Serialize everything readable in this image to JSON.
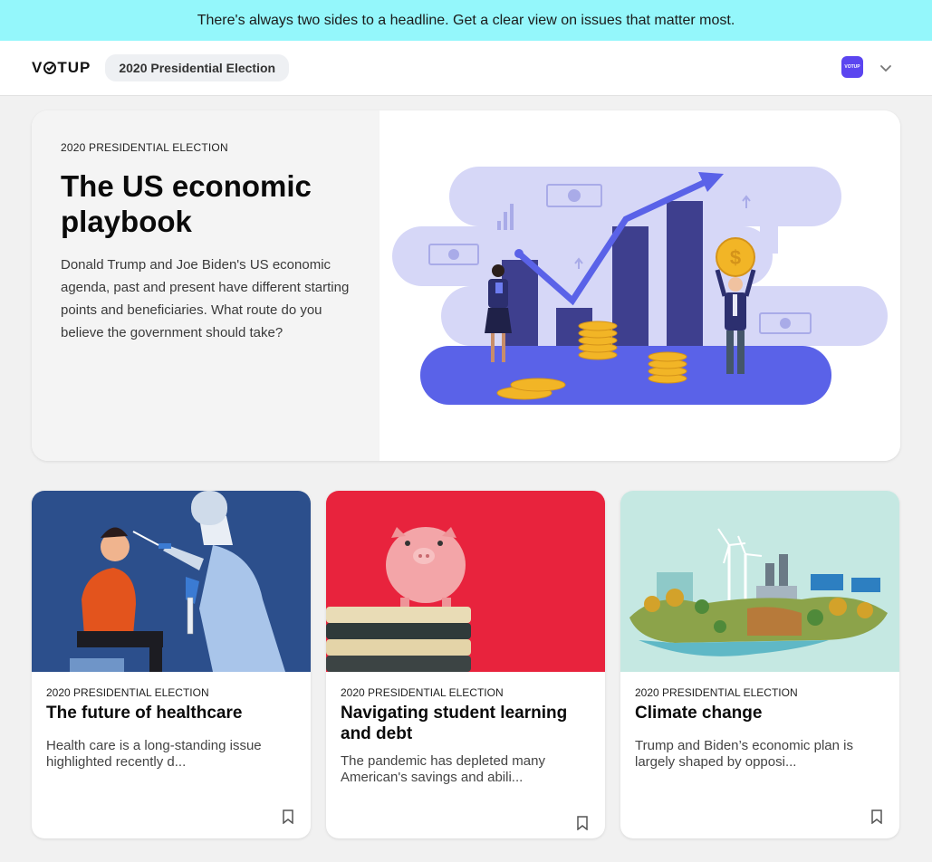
{
  "banner": {
    "text": "There's always two sides to a headline. Get a clear view on issues that matter most."
  },
  "header": {
    "logo_left": "V",
    "logo_right": "TUP",
    "pill_label": "2020 Presidential Election",
    "avatar_text": "VOTUP"
  },
  "hero": {
    "tag": "2020 PRESIDENTIAL ELECTION",
    "title": "The US economic playbook",
    "description": "Donald Trump and Joe Biden's US economic agenda, past and present have different starting points and beneficiaries. What route do you believe the government should take?"
  },
  "cards": [
    {
      "tag": "2020 PRESIDENTIAL ELECTION",
      "title": "The future of healthcare",
      "description": "Health care is a long-standing issue highlighted recently d..."
    },
    {
      "tag": "2020 PRESIDENTIAL ELECTION",
      "title": "Navigating student learning and debt",
      "description": "The pandemic has depleted many American's savings and abili..."
    },
    {
      "tag": "2020 PRESIDENTIAL ELECTION",
      "title": "Climate change",
      "description": "Trump and Biden’s economic plan is largely shaped by opposi..."
    }
  ],
  "colors": {
    "banner": "#94f7fb",
    "brand": "#5b45f0",
    "hero_art_bg": "#d6d7f7",
    "hero_art_floor": "#5a62e8"
  },
  "icons": [
    "chevron-down-icon",
    "bookmark-icon"
  ]
}
